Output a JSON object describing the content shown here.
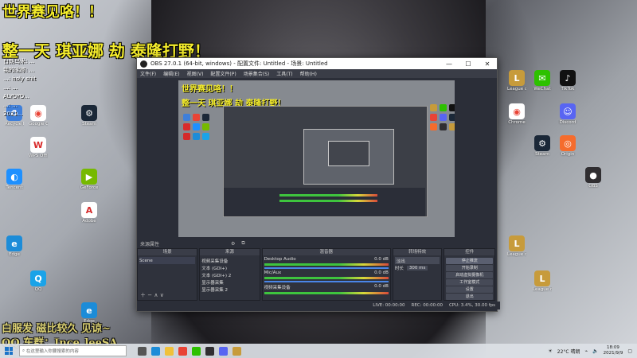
{
  "overlay": {
    "line1": "世界赛见咯！！",
    "line2": "整一天 琪亚娜 劫 泰隆打野！",
    "line3": "白服发    磁比较久 见谅~",
    "line4": "QQ 车群：Ince_leeSA"
  },
  "chat": [
    "白朗乌米: ...",
    "我的昵称: ...",
    "...: holy shit",
    "...: ...",
    "ALYOYO...",
    "...: ...",
    "2021..."
  ],
  "obs": {
    "title": "OBS 27.0.1 (64-bit, windows) - 配置文件: Untitled - 场景: Untitled",
    "menu": [
      "文件(F)",
      "编辑(E)",
      "视图(V)",
      "配置文件(P)",
      "场景集合(S)",
      "工具(T)",
      "帮助(H)"
    ],
    "preview_text1": "世界赛见咯！！",
    "preview_text2": "整一天 琪亚娜 劫 泰隆打野！",
    "source_label": "来源属性",
    "scenes": {
      "header": "场景",
      "items": [
        "Scene"
      ]
    },
    "sources": {
      "header": "来源",
      "items": [
        "视频采集设备",
        "文本 (GDI+)",
        "文本 (GDI+) 2",
        "显示器采集",
        "显示器采集 2"
      ]
    },
    "mixer": {
      "header": "混音器",
      "tracks": [
        {
          "name": "Desktop Audio",
          "level": "0.0 dB"
        },
        {
          "name": "Mic/Aux",
          "level": "0.0 dB"
        },
        {
          "name": "视频采集设备",
          "level": "0.0 dB"
        }
      ]
    },
    "transitions": {
      "header": "转场特效",
      "type": "淡出",
      "duration_label": "时长",
      "duration": "300 ms"
    },
    "controls": {
      "header": "控件",
      "buttons": [
        "停止推流",
        "开始录制",
        "启动虚拟摄像机",
        "工作室模式",
        "设置",
        "退出"
      ]
    },
    "status": {
      "live": "LIVE: 00:00:00",
      "rec": "REC: 00:00:00",
      "cpu": "CPU: 3.4%, 30.00 fps"
    }
  },
  "taskbar": {
    "search_placeholder": "在这里输入你要搜索的内容",
    "weather": "22°C 晴朗",
    "time": "18:09",
    "date": "2021/9/9"
  },
  "desktop_left": [
    {
      "label": "Recycle Bin",
      "color": "#3f7fd9"
    },
    {
      "label": "Google Chrome",
      "color": "#e94335"
    },
    {
      "label": "Steam",
      "color": "#1b2838"
    },
    {
      "label": "WPS Office",
      "color": "#d92b2b"
    },
    {
      "label": "Tencent",
      "color": "#1e90ff"
    },
    {
      "label": "GeForce",
      "color": "#76b900"
    },
    {
      "label": "Adobe",
      "color": "#d42a2a"
    },
    {
      "label": "Edge",
      "color": "#1c8cd8"
    },
    {
      "label": "QQ",
      "color": "#1aa3e8"
    }
  ],
  "desktop_right": [
    {
      "label": "League of Legends",
      "color": "#c79b3b"
    },
    {
      "label": "WeChat",
      "color": "#2dc100"
    },
    {
      "label": "TikTok",
      "color": "#111"
    },
    {
      "label": "Chrome",
      "color": "#e94335"
    },
    {
      "label": "Discord",
      "color": "#5865f2"
    },
    {
      "label": "Steam",
      "color": "#1b2838"
    },
    {
      "label": "Origin",
      "color": "#f56c2d"
    },
    {
      "label": "OBS",
      "color": "#302e31"
    }
  ]
}
